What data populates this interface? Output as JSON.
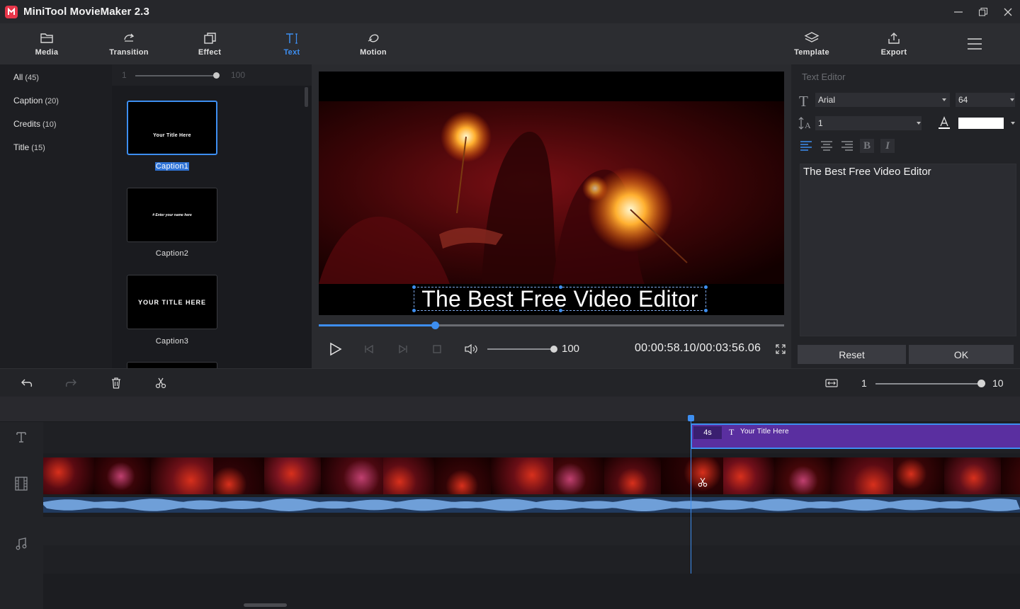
{
  "app": {
    "title": "MiniTool MovieMaker 2.3"
  },
  "toolbar": {
    "tabs": [
      {
        "label": "Media",
        "icon": "folder-icon"
      },
      {
        "label": "Transition",
        "icon": "transition-icon"
      },
      {
        "label": "Effect",
        "icon": "effect-icon"
      },
      {
        "label": "Text",
        "icon": "text-icon",
        "active": true
      },
      {
        "label": "Motion",
        "icon": "motion-icon"
      }
    ],
    "template_label": "Template",
    "export_label": "Export"
  },
  "categories": [
    {
      "name": "All",
      "count": "(45)"
    },
    {
      "name": "Caption",
      "count": "(20)"
    },
    {
      "name": "Credits",
      "count": "(10)"
    },
    {
      "name": "Title",
      "count": "(15)"
    }
  ],
  "thumb_size": {
    "min": "1",
    "max": "100"
  },
  "captions": [
    {
      "label": "Caption1",
      "preview": "Your Title Here",
      "selected": true
    },
    {
      "label": "Caption2",
      "preview": "# Enter your name here"
    },
    {
      "label": "Caption3",
      "preview": "YOUR TITLE HERE"
    }
  ],
  "preview": {
    "caption_text": "The Best Free Video Editor",
    "progress": 0.25,
    "volume": "100",
    "timecode": "00:00:58.10/00:03:56.06"
  },
  "editor": {
    "title": "Text Editor",
    "font": "Arial",
    "size": "64",
    "line_spacing": "1",
    "text_color": "#ffffff",
    "text": "The Best Free Video Editor",
    "reset_label": "Reset",
    "ok_label": "OK"
  },
  "timeline": {
    "zoom_min": "1",
    "zoom_max": "10",
    "clip_duration": "4s",
    "clip_title": "Your Title Here"
  },
  "colors": {
    "accent": "#3d8ef0",
    "title_clip": "#5a2fa0"
  }
}
